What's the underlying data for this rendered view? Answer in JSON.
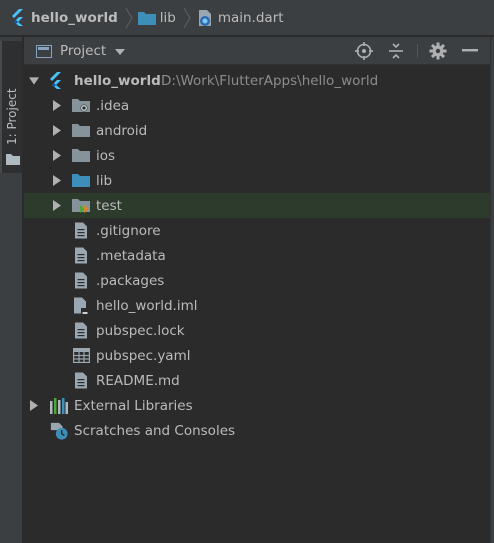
{
  "breadcrumb": {
    "items": [
      {
        "label": "hello_world",
        "icon": "flutter-icon"
      },
      {
        "label": "lib",
        "icon": "folder-icon"
      },
      {
        "label": "main.dart",
        "icon": "dart-file-icon"
      }
    ]
  },
  "tool_strip": {
    "project_tab": "1: Project"
  },
  "panel": {
    "view_label": "Project",
    "buttons": [
      "locate-icon",
      "collapse-all-icon",
      "settings-gear-icon",
      "hide-minimize-icon"
    ]
  },
  "tree": {
    "root": {
      "label": "hello_world",
      "path": "D:\\Work\\FlutterApps\\hello_world"
    },
    "items": [
      {
        "label": ".idea",
        "icon": "idea-folder-icon"
      },
      {
        "label": "android",
        "icon": "folder-icon"
      },
      {
        "label": "ios",
        "icon": "folder-icon"
      },
      {
        "label": "lib",
        "icon": "source-folder-icon"
      },
      {
        "label": "test",
        "icon": "test-folder-icon"
      },
      {
        "label": ".gitignore",
        "icon": "text-file-icon"
      },
      {
        "label": ".metadata",
        "icon": "text-file-icon"
      },
      {
        "label": ".packages",
        "icon": "text-file-icon"
      },
      {
        "label": "hello_world.iml",
        "icon": "module-file-icon"
      },
      {
        "label": "pubspec.lock",
        "icon": "text-file-icon"
      },
      {
        "label": "pubspec.yaml",
        "icon": "yaml-table-icon"
      },
      {
        "label": "README.md",
        "icon": "text-file-icon"
      }
    ],
    "external_libraries": "External Libraries",
    "scratches": "Scratches and Consoles"
  },
  "colors": {
    "background": "#2b2b2b",
    "toolbar": "#3c3f41",
    "text": "#bbbbbb",
    "selected_row": "#2d3b2d",
    "flutter_blue": "#47c5fb",
    "folder_gray": "#87939a",
    "source_folder_blue": "#3d8eb9"
  }
}
